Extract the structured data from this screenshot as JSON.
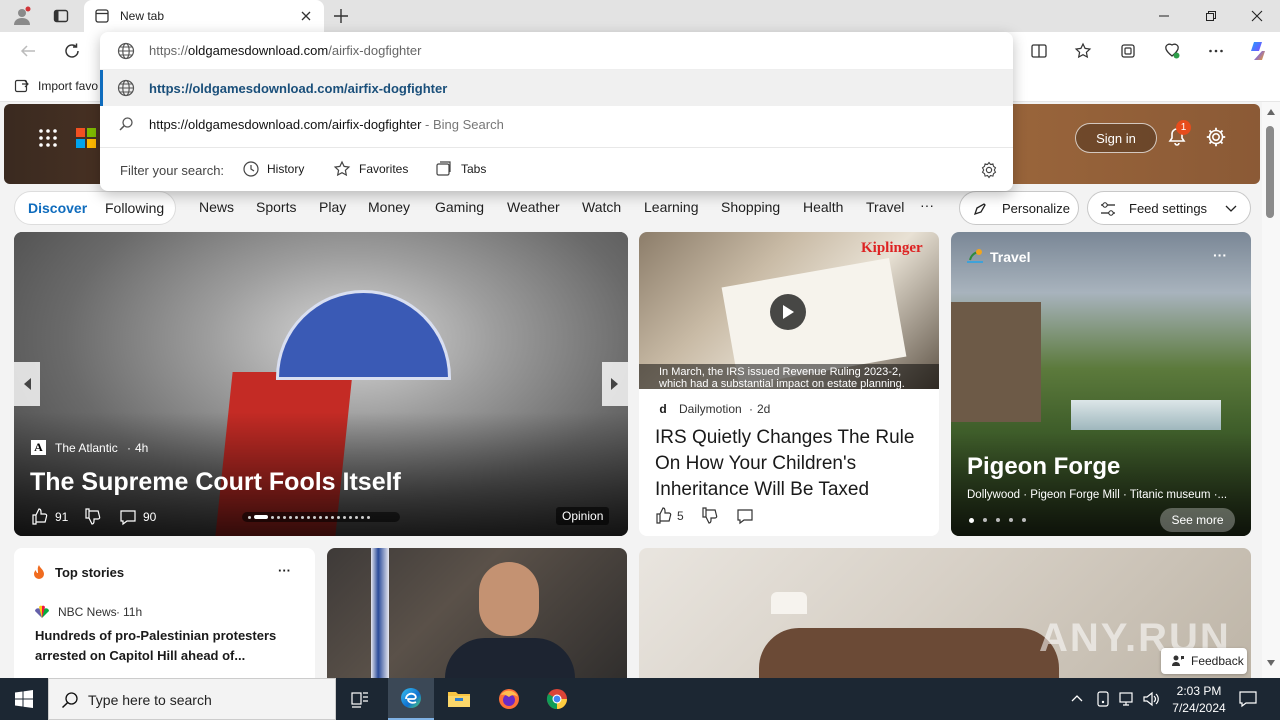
{
  "browser": {
    "tab_title": "New tab",
    "address_value": "https://oldgamesdownload.com/airfix-dogfighter",
    "address_host": "oldgamesdownload.com",
    "address_path": "/airfix-dogfighter",
    "address_scheme": "https://",
    "favbar_import": "Import favo",
    "suggestion_url": "https://oldgamesdownload.com/airfix-dogfighter",
    "suggestion_search": "https://oldgamesdownload.com/airfix-dogfighter",
    "suggestion_search_suffix": " - Bing Search",
    "filter_label": "Filter your search:",
    "filters": [
      "History",
      "Favorites",
      "Tabs"
    ]
  },
  "header": {
    "sign_in": "Sign in",
    "notif_count": "1"
  },
  "feed_nav": {
    "discover": "Discover",
    "following": "Following",
    "items": [
      "News",
      "Sports",
      "Play",
      "Money",
      "Gaming",
      "Weather",
      "Watch",
      "Learning",
      "Shopping",
      "Health",
      "Travel"
    ],
    "more": "···",
    "personalize": "Personalize",
    "feed_settings": "Feed settings"
  },
  "cards": {
    "main": {
      "source": "The Atlantic",
      "age": "4h",
      "title": "The Supreme Court Fools Itself",
      "likes": "91",
      "comments": "90",
      "tag": "Opinion"
    },
    "irs": {
      "brand": "Kiplinger",
      "caption": "In March, the IRS issued Revenue Ruling 2023-2, which had a substantial impact on estate planning.",
      "source": "Dailymotion",
      "age": "2d",
      "title": "IRS Quietly Changes The Rule On How Your Children's Inheritance Will Be Taxed",
      "likes": "5"
    },
    "travel": {
      "category": "Travel",
      "title": "Pigeon Forge",
      "subtitle": "Dollywood · Pigeon Forge Mill · Titanic museum ·...",
      "see_more": "See more"
    },
    "top_stories": {
      "title": "Top stories",
      "source": "NBC News",
      "age": "11h",
      "headline": "Hundreds of pro-Palestinian protesters arrested on Capitol Hill ahead of..."
    },
    "feedback": "Feedback",
    "watermark": "ANY.RUN"
  },
  "taskbar": {
    "search_placeholder": "Type here to search",
    "time": "2:03 PM",
    "date": "7/24/2024"
  },
  "colors": {
    "accent": "#0f6cbd",
    "taskbar": "#1c2733",
    "notif_badge": "#e74c1c"
  }
}
